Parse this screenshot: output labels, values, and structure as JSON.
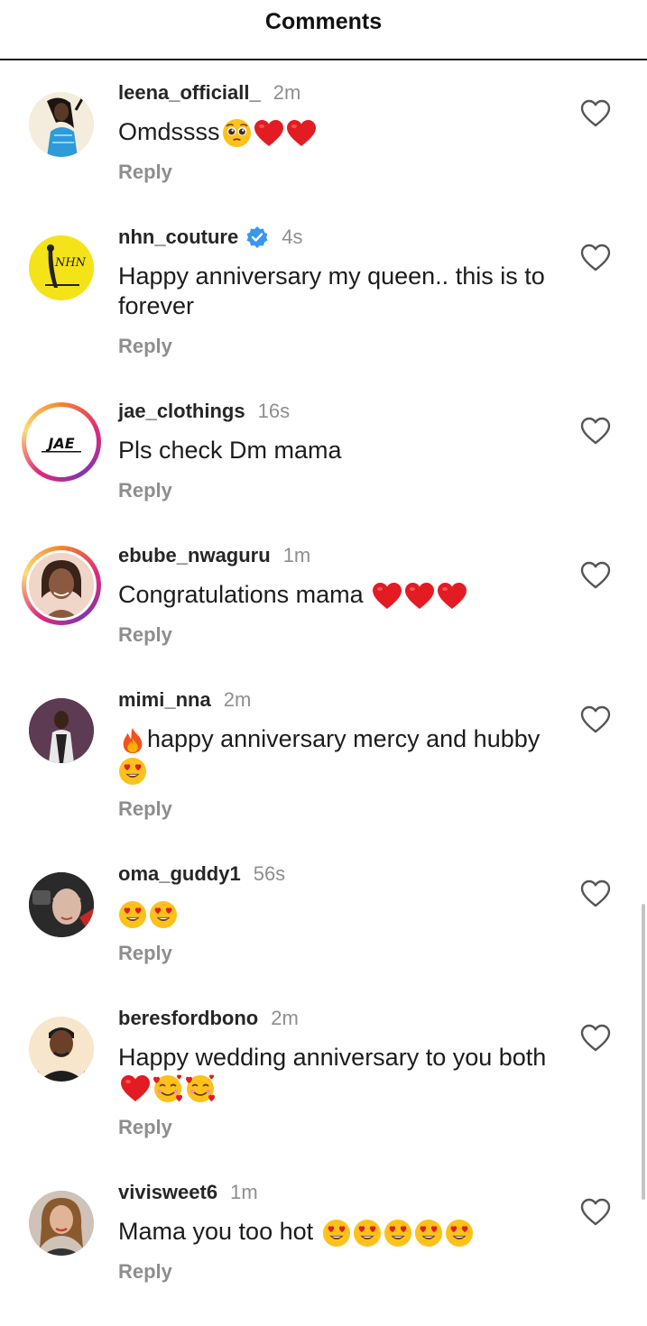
{
  "header": {
    "title": "Comments"
  },
  "reply_label": "Reply",
  "comments": [
    {
      "username": "leena_officiall_",
      "time": "2m",
      "text": "Omdssss",
      "emojis": [
        "pleading-face-emoji",
        "red-heart-emoji",
        "red-heart-emoji"
      ],
      "verified": false,
      "story_ring": false
    },
    {
      "username": "nhn_couture",
      "time": "4s",
      "text": "Happy anniversary my queen.. this is to forever",
      "emojis": [],
      "verified": true,
      "story_ring": false
    },
    {
      "username": "jae_clothings",
      "time": "16s",
      "text": "Pls check Dm mama",
      "emojis": [],
      "verified": false,
      "story_ring": true
    },
    {
      "username": "ebube_nwaguru",
      "time": "1m",
      "text": "Congratulations mama",
      "emojis": [
        "red-heart-emoji",
        "red-heart-emoji",
        "red-heart-emoji"
      ],
      "verified": false,
      "story_ring": true
    },
    {
      "username": "mimi_nna",
      "time": "2m",
      "text": "happy anniversary mercy and hubby",
      "emojis": [
        "fire-emoji",
        "heart-eyes-emoji"
      ],
      "verified": false,
      "story_ring": false
    },
    {
      "username": "oma_guddy1",
      "time": "56s",
      "text": "",
      "emojis": [
        "heart-eyes-emoji",
        "heart-eyes-emoji"
      ],
      "verified": false,
      "story_ring": false
    },
    {
      "username": "beresfordbono",
      "time": "2m",
      "text": "Happy wedding anniversary to you both",
      "emojis": [
        "red-heart-emoji",
        "smiling-face-with-hearts-emoji",
        "smiling-face-with-hearts-emoji"
      ],
      "verified": false,
      "story_ring": false
    },
    {
      "username": "vivisweet6",
      "time": "1m",
      "text": "Mama you too hot",
      "emojis": [
        "heart-eyes-emoji",
        "heart-eyes-emoji",
        "heart-eyes-emoji",
        "heart-eyes-emoji",
        "heart-eyes-emoji"
      ],
      "verified": false,
      "story_ring": false
    }
  ],
  "avatars": {
    "jae_logo_text": "JAE",
    "nhn_logo_text": "NHN"
  },
  "colors": {
    "verified_blue": "#3897f0",
    "heart_red": "#e0245e",
    "username": "#262626",
    "muted": "#8e8e8e"
  }
}
